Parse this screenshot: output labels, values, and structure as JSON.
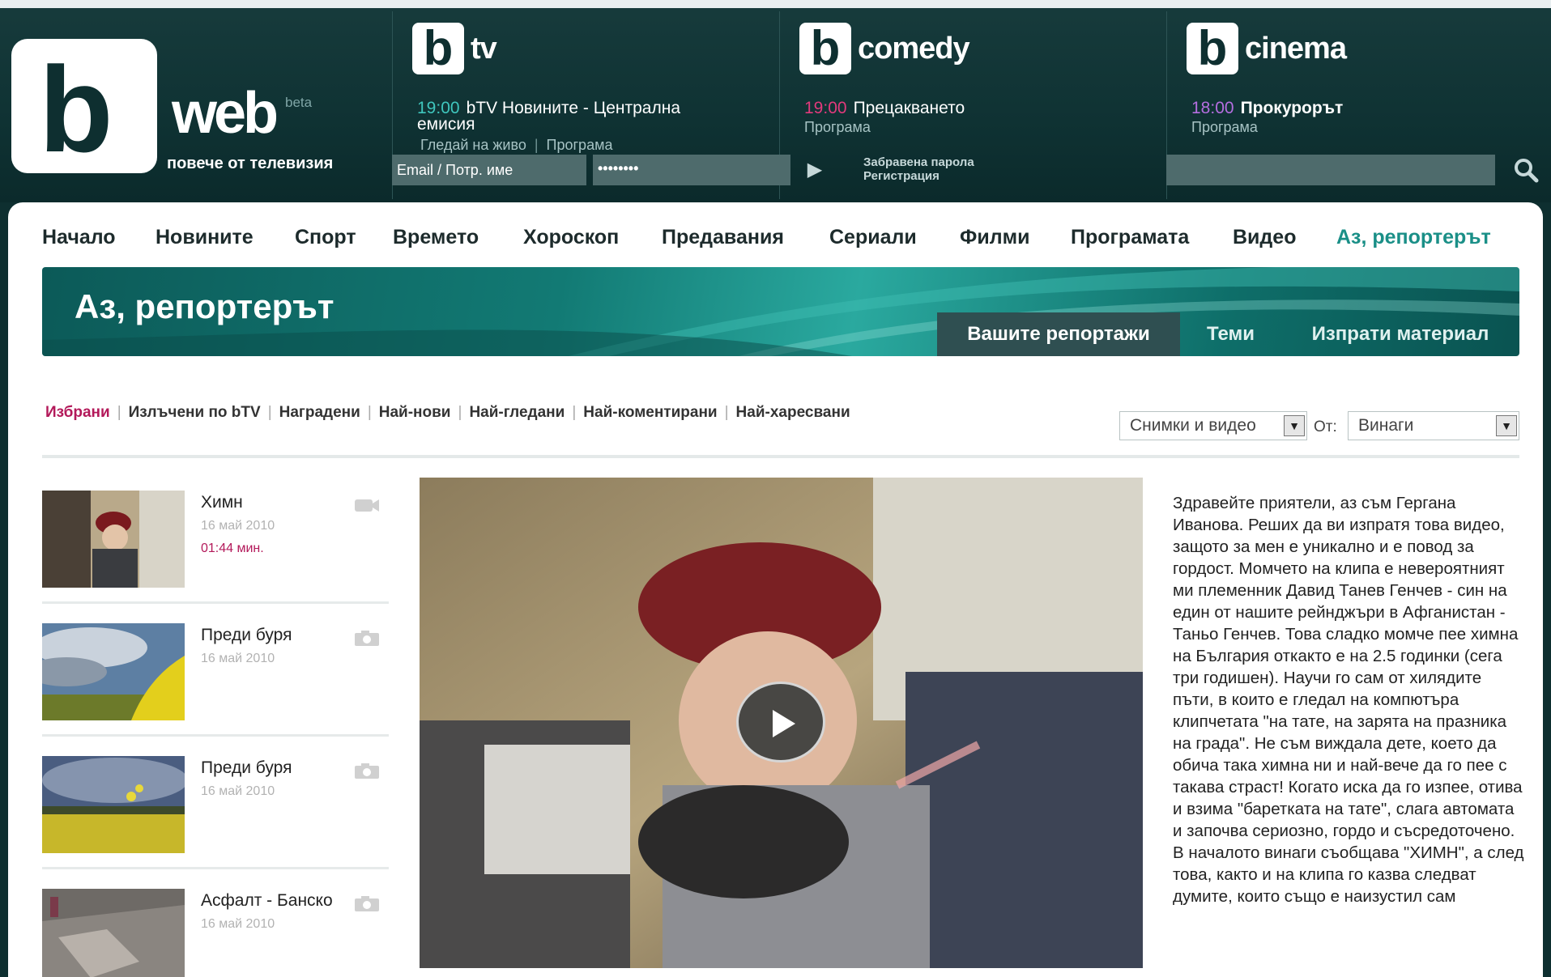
{
  "header": {
    "logo_web": "web",
    "logo_beta": "beta",
    "tagline": "повече от телевизия",
    "login": {
      "email_placeholder": "Email / Потр. име",
      "password_value": "••••••••",
      "forgot_password": "Забравена парола",
      "register": "Регистрация"
    },
    "channels": [
      {
        "logo_letter": "b",
        "name": "tv",
        "time": "19:00",
        "show": "bTV Новините - Централна емисия",
        "watch_live": "Гледай на живо",
        "program": "Програма",
        "time_color": "#3fc6bd"
      },
      {
        "logo_letter": "b",
        "name": "comedy",
        "time": "19:00",
        "show": "Прецакването",
        "program": "Програма",
        "time_color": "#e23a7c"
      },
      {
        "logo_letter": "b",
        "name": "cinema",
        "time": "18:00",
        "show": "Прокурорът",
        "program": "Програма",
        "time_color": "#b56ee0"
      }
    ]
  },
  "nav": {
    "items": [
      "Начало",
      "Новините",
      "Спорт",
      "Времето",
      "Хороскоп",
      "Предавания",
      "Сериали",
      "Филми",
      "Програмата",
      "Видео",
      "Аз, репортерът"
    ]
  },
  "section": {
    "title": "Аз, репортерът",
    "tabs": [
      "Вашите репортажи",
      "Теми",
      "Изпрати материал"
    ]
  },
  "filters": {
    "items": [
      "Избрани",
      "Излъчени по bTV",
      "Наградени",
      "Най-нови",
      "Най-гледани",
      "Най-коментирани",
      "Най-харесвани"
    ],
    "media_select": "Снимки и видео",
    "from_label": "От:",
    "period_select": "Винаги"
  },
  "list": [
    {
      "title": "Химн",
      "date": "16 май 2010",
      "duration": "01:44 мин.",
      "type": "video-camera-icon"
    },
    {
      "title": "Преди буря",
      "date": "16 май 2010",
      "type": "photo-camera-icon"
    },
    {
      "title": "Преди буря",
      "date": "16 май 2010",
      "type": "photo-camera-icon"
    },
    {
      "title": "Асфалт - Банско",
      "date": "16 май 2010",
      "type": "photo-camera-icon"
    }
  ],
  "description": "Здравейте приятели, аз съм Гергана Иванова. Реших да ви изпратя това видео, защото за мен е уникално и е повод за гордост. Момчето на клипа е невероятният ми племенник Давид Танев Генчев - син на един от нашите рейнджъри в Афганистан - Таньо Генчев. Това сладко момче пее химна на България откакто е на 2.5 годинки (сега три годишен). Научи го сам от хилядите пъти, в които е гледал на компютъра клипчетата \"на тате, на зарята на празника на града\". Не съм виждала дете, което да обича така химна ни и най-вече да го пее с такава страст! Когато иска да го изпее, отива и взима \"баретката на тате\", слага автомата и започва сериозно, гордо и съсредоточено. В началото винаги съобщава \"ХИМН\", а след това, както и на клипа го казва следват думите, които също е наизустил сам",
  "colors": {
    "accent_teal": "#1a8f87",
    "accent_magenta": "#b3195a",
    "header_bg": "#0f3233"
  }
}
